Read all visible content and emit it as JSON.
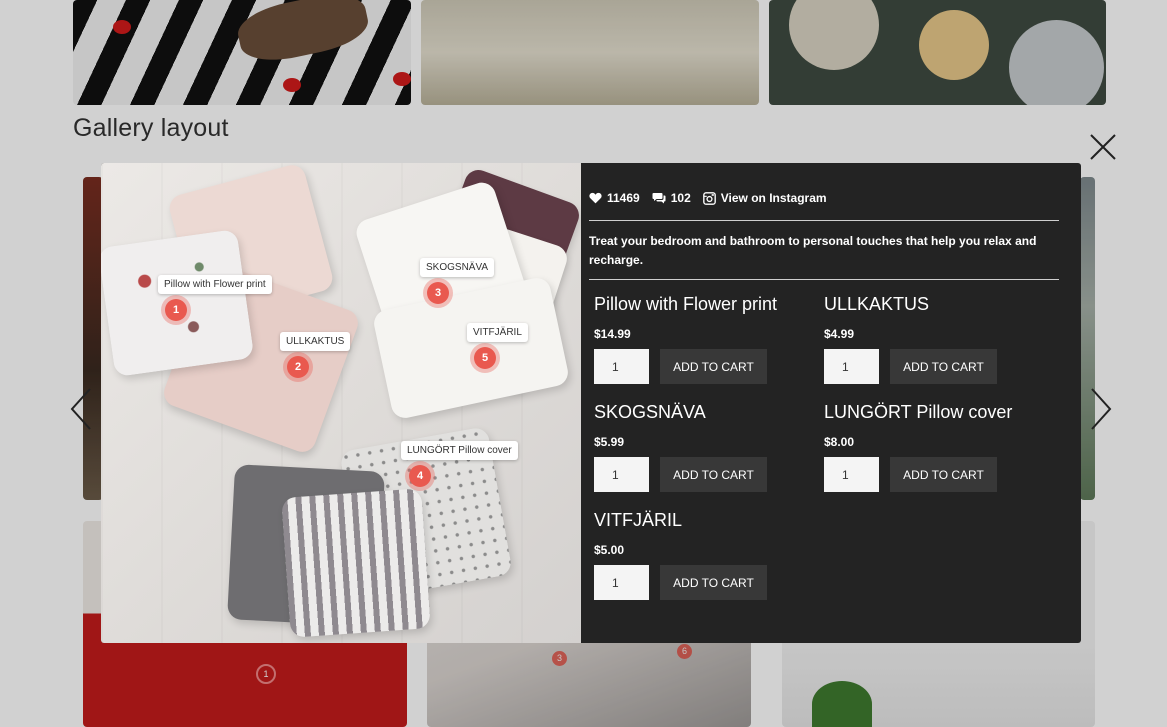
{
  "page": {
    "gallery_title": "Gallery layout"
  },
  "lightbox": {
    "likes": "11469",
    "comments": "102",
    "instagram_link": "View on Instagram",
    "caption": "Treat your bedroom and bathroom to personal touches that help you relax and recharge.",
    "hotspots": [
      {
        "number": "1",
        "label": "Pillow with Flower print"
      },
      {
        "number": "2",
        "label": "ULLKAKTUS"
      },
      {
        "number": "3",
        "label": "SKOGSNÄVA"
      },
      {
        "number": "4",
        "label": "LUNGÖRT Pillow cover"
      },
      {
        "number": "5",
        "label": "VITFJÄRIL"
      }
    ],
    "products": [
      {
        "name": "Pillow with Flower print",
        "price": "$14.99",
        "qty": "1",
        "button": "ADD TO CART"
      },
      {
        "name": "ULLKAKTUS",
        "price": "$4.99",
        "qty": "1",
        "button": "ADD TO CART"
      },
      {
        "name": "SKOGSNÄVA",
        "price": "$5.99",
        "qty": "1",
        "button": "ADD TO CART"
      },
      {
        "name": "LUNGÖRT Pillow cover",
        "price": "$8.00",
        "qty": "1",
        "button": "ADD TO CART"
      },
      {
        "name": "VITFJÄRIL",
        "price": "$5.00",
        "qty": "1",
        "button": "ADD TO CART"
      }
    ]
  },
  "background_hotspots": [
    "1",
    "3",
    "6"
  ],
  "colors": {
    "hotspot": "#e9594f",
    "panel": "#232323",
    "button": "#383838"
  },
  "icons": [
    "heart-icon",
    "comment-icon",
    "instagram-icon",
    "close-icon",
    "chevron-left-icon",
    "chevron-right-icon"
  ]
}
